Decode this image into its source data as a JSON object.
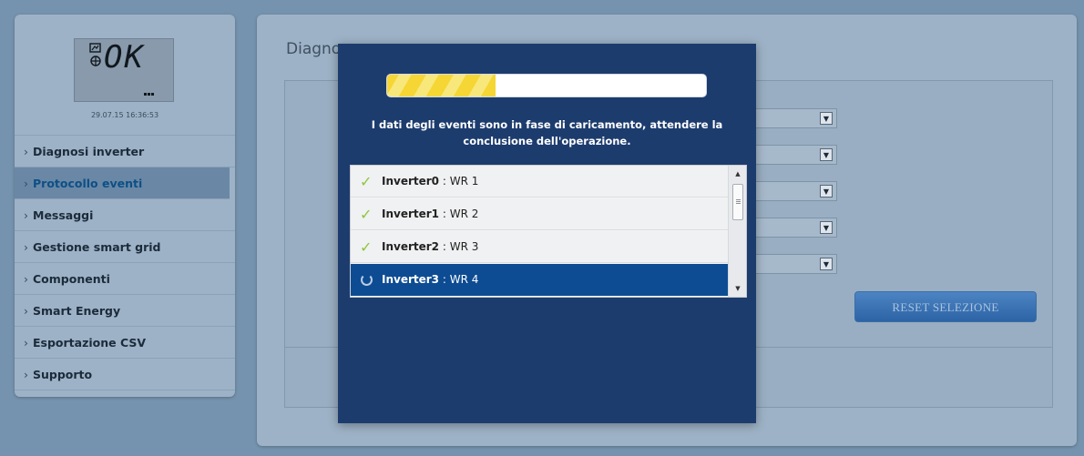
{
  "device": {
    "display_text": "OK",
    "timestamp": "29.07.15 16:36:53"
  },
  "sidebar": {
    "items": [
      {
        "label": "Diagnosi inverter",
        "active": false
      },
      {
        "label": "Protocollo eventi",
        "active": true
      },
      {
        "label": "Messaggi",
        "active": false
      },
      {
        "label": "Gestione smart grid",
        "active": false
      },
      {
        "label": "Componenti",
        "active": false
      },
      {
        "label": "Smart Energy",
        "active": false
      },
      {
        "label": "Esportazione CSV",
        "active": false
      },
      {
        "label": "Supporto",
        "active": false
      }
    ]
  },
  "main": {
    "title": "Diagnosi",
    "reset_label": "RESET SELEZIONE",
    "select_count": 5
  },
  "modal": {
    "progress_percent": 34,
    "message": "I dati degli eventi sono in fase di caricamento, attendere la conclusione dell'operazione.",
    "inverters": [
      {
        "name": "Inverter0",
        "separator": " : ",
        "label": "WR 1",
        "status": "done"
      },
      {
        "name": "Inverter1",
        "separator": " : ",
        "label": "WR 2",
        "status": "done"
      },
      {
        "name": "Inverter2",
        "separator": " : ",
        "label": "WR 3",
        "status": "done"
      },
      {
        "name": "Inverter3",
        "separator": " : ",
        "label": "WR 4",
        "status": "loading"
      }
    ]
  },
  "colors": {
    "accent": "#0d4c93",
    "modal_bg": "#1d3c6e",
    "done_check": "#8cc63e",
    "progress": "#f5d634"
  }
}
